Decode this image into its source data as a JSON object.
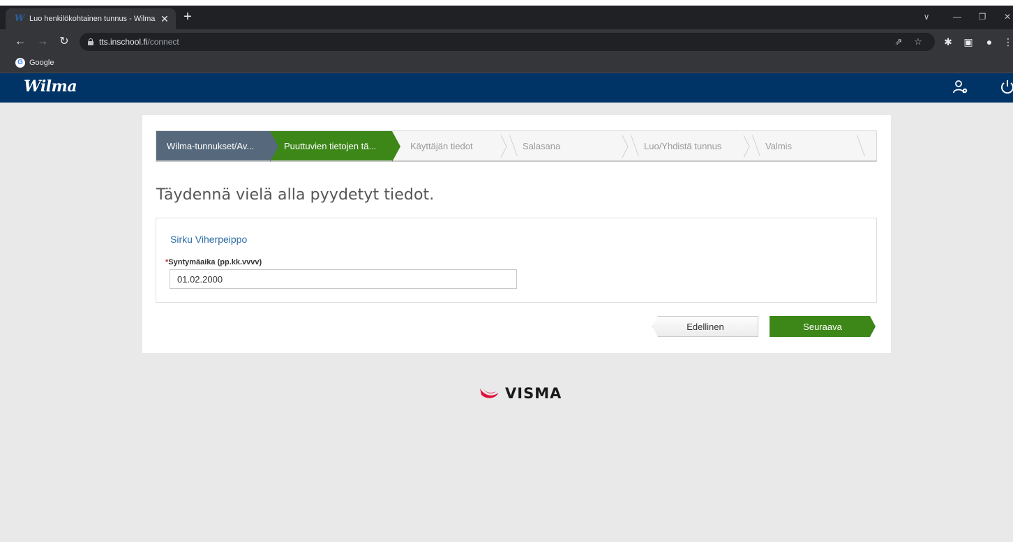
{
  "browser": {
    "tab_title": "Luo henkilökohtainen tunnus - Wilma",
    "tab_favicon": "W",
    "tab_close": "✕",
    "new_tab": "+",
    "url_host": "tts.inschool.fi",
    "url_path": "/connect",
    "bookmark_label": "Google",
    "icons": [
      "back-icon",
      "forward-icon",
      "reload-icon",
      "lock-icon",
      "share-icon",
      "star-icon",
      "extensions-icon",
      "side-panel-icon",
      "profile-icon",
      "menu-icon"
    ]
  },
  "app": {
    "logo": "Wilma",
    "header_icons": [
      "user-settings-icon",
      "power-icon"
    ]
  },
  "steps": [
    {
      "label": "Wilma-tunnukset/Av...",
      "state": "done"
    },
    {
      "label": "Puuttuvien tietojen tä...",
      "state": "active"
    },
    {
      "label": "Käyttäjän tiedot",
      "state": "todo"
    },
    {
      "label": "Salasana",
      "state": "todo"
    },
    {
      "label": "Luo/Yhdistä tunnus",
      "state": "todo"
    },
    {
      "label": "Valmis",
      "state": "todo"
    }
  ],
  "page": {
    "heading": "Täydennä vielä alla pyydetyt tiedot."
  },
  "form": {
    "person_name": "Sirku Viherpeippo",
    "birthdate_required_mark": "*",
    "birthdate_label": "Syntymäaika (pp.kk.vvvv)",
    "birthdate_value": "01.02.2000"
  },
  "buttons": {
    "previous": "Edellinen",
    "next": "Seuraava"
  },
  "footer": {
    "brand": "VISMA"
  },
  "colors": {
    "header_bg": "#003467",
    "step_done": "#56697c",
    "step_active": "#3d8719",
    "next_button": "#3d8719",
    "link": "#2d6ca5",
    "visma_red": "#e0103a"
  }
}
